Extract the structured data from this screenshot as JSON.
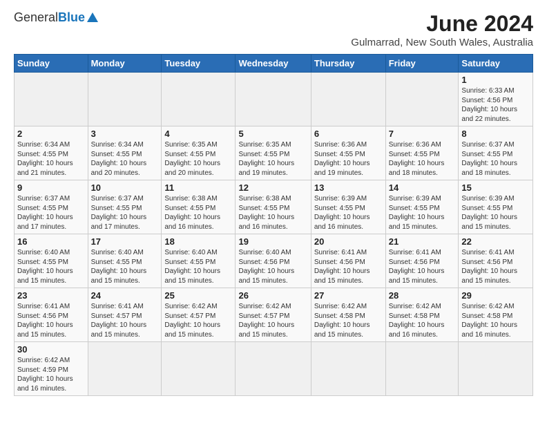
{
  "header": {
    "logo_general": "General",
    "logo_blue": "Blue",
    "month_year": "June 2024",
    "location": "Gulmarrad, New South Wales, Australia"
  },
  "days_of_week": [
    "Sunday",
    "Monday",
    "Tuesday",
    "Wednesday",
    "Thursday",
    "Friday",
    "Saturday"
  ],
  "weeks": [
    [
      {
        "day": "",
        "info": ""
      },
      {
        "day": "",
        "info": ""
      },
      {
        "day": "",
        "info": ""
      },
      {
        "day": "",
        "info": ""
      },
      {
        "day": "",
        "info": ""
      },
      {
        "day": "",
        "info": ""
      },
      {
        "day": "1",
        "info": "Sunrise: 6:33 AM\nSunset: 4:56 PM\nDaylight: 10 hours\nand 22 minutes."
      }
    ],
    [
      {
        "day": "2",
        "info": "Sunrise: 6:34 AM\nSunset: 4:55 PM\nDaylight: 10 hours\nand 21 minutes."
      },
      {
        "day": "3",
        "info": "Sunrise: 6:34 AM\nSunset: 4:55 PM\nDaylight: 10 hours\nand 20 minutes."
      },
      {
        "day": "4",
        "info": "Sunrise: 6:35 AM\nSunset: 4:55 PM\nDaylight: 10 hours\nand 20 minutes."
      },
      {
        "day": "5",
        "info": "Sunrise: 6:35 AM\nSunset: 4:55 PM\nDaylight: 10 hours\nand 19 minutes."
      },
      {
        "day": "6",
        "info": "Sunrise: 6:36 AM\nSunset: 4:55 PM\nDaylight: 10 hours\nand 19 minutes."
      },
      {
        "day": "7",
        "info": "Sunrise: 6:36 AM\nSunset: 4:55 PM\nDaylight: 10 hours\nand 18 minutes."
      },
      {
        "day": "8",
        "info": "Sunrise: 6:37 AM\nSunset: 4:55 PM\nDaylight: 10 hours\nand 18 minutes."
      }
    ],
    [
      {
        "day": "9",
        "info": "Sunrise: 6:37 AM\nSunset: 4:55 PM\nDaylight: 10 hours\nand 17 minutes."
      },
      {
        "day": "10",
        "info": "Sunrise: 6:37 AM\nSunset: 4:55 PM\nDaylight: 10 hours\nand 17 minutes."
      },
      {
        "day": "11",
        "info": "Sunrise: 6:38 AM\nSunset: 4:55 PM\nDaylight: 10 hours\nand 16 minutes."
      },
      {
        "day": "12",
        "info": "Sunrise: 6:38 AM\nSunset: 4:55 PM\nDaylight: 10 hours\nand 16 minutes."
      },
      {
        "day": "13",
        "info": "Sunrise: 6:39 AM\nSunset: 4:55 PM\nDaylight: 10 hours\nand 16 minutes."
      },
      {
        "day": "14",
        "info": "Sunrise: 6:39 AM\nSunset: 4:55 PM\nDaylight: 10 hours\nand 15 minutes."
      },
      {
        "day": "15",
        "info": "Sunrise: 6:39 AM\nSunset: 4:55 PM\nDaylight: 10 hours\nand 15 minutes."
      }
    ],
    [
      {
        "day": "16",
        "info": "Sunrise: 6:40 AM\nSunset: 4:55 PM\nDaylight: 10 hours\nand 15 minutes."
      },
      {
        "day": "17",
        "info": "Sunrise: 6:40 AM\nSunset: 4:55 PM\nDaylight: 10 hours\nand 15 minutes."
      },
      {
        "day": "18",
        "info": "Sunrise: 6:40 AM\nSunset: 4:55 PM\nDaylight: 10 hours\nand 15 minutes."
      },
      {
        "day": "19",
        "info": "Sunrise: 6:40 AM\nSunset: 4:56 PM\nDaylight: 10 hours\nand 15 minutes."
      },
      {
        "day": "20",
        "info": "Sunrise: 6:41 AM\nSunset: 4:56 PM\nDaylight: 10 hours\nand 15 minutes."
      },
      {
        "day": "21",
        "info": "Sunrise: 6:41 AM\nSunset: 4:56 PM\nDaylight: 10 hours\nand 15 minutes."
      },
      {
        "day": "22",
        "info": "Sunrise: 6:41 AM\nSunset: 4:56 PM\nDaylight: 10 hours\nand 15 minutes."
      }
    ],
    [
      {
        "day": "23",
        "info": "Sunrise: 6:41 AM\nSunset: 4:56 PM\nDaylight: 10 hours\nand 15 minutes."
      },
      {
        "day": "24",
        "info": "Sunrise: 6:41 AM\nSunset: 4:57 PM\nDaylight: 10 hours\nand 15 minutes."
      },
      {
        "day": "25",
        "info": "Sunrise: 6:42 AM\nSunset: 4:57 PM\nDaylight: 10 hours\nand 15 minutes."
      },
      {
        "day": "26",
        "info": "Sunrise: 6:42 AM\nSunset: 4:57 PM\nDaylight: 10 hours\nand 15 minutes."
      },
      {
        "day": "27",
        "info": "Sunrise: 6:42 AM\nSunset: 4:58 PM\nDaylight: 10 hours\nand 15 minutes."
      },
      {
        "day": "28",
        "info": "Sunrise: 6:42 AM\nSunset: 4:58 PM\nDaylight: 10 hours\nand 16 minutes."
      },
      {
        "day": "29",
        "info": "Sunrise: 6:42 AM\nSunset: 4:58 PM\nDaylight: 10 hours\nand 16 minutes."
      }
    ],
    [
      {
        "day": "30",
        "info": "Sunrise: 6:42 AM\nSunset: 4:59 PM\nDaylight: 10 hours\nand 16 minutes."
      },
      {
        "day": "",
        "info": ""
      },
      {
        "day": "",
        "info": ""
      },
      {
        "day": "",
        "info": ""
      },
      {
        "day": "",
        "info": ""
      },
      {
        "day": "",
        "info": ""
      },
      {
        "day": "",
        "info": ""
      }
    ]
  ]
}
